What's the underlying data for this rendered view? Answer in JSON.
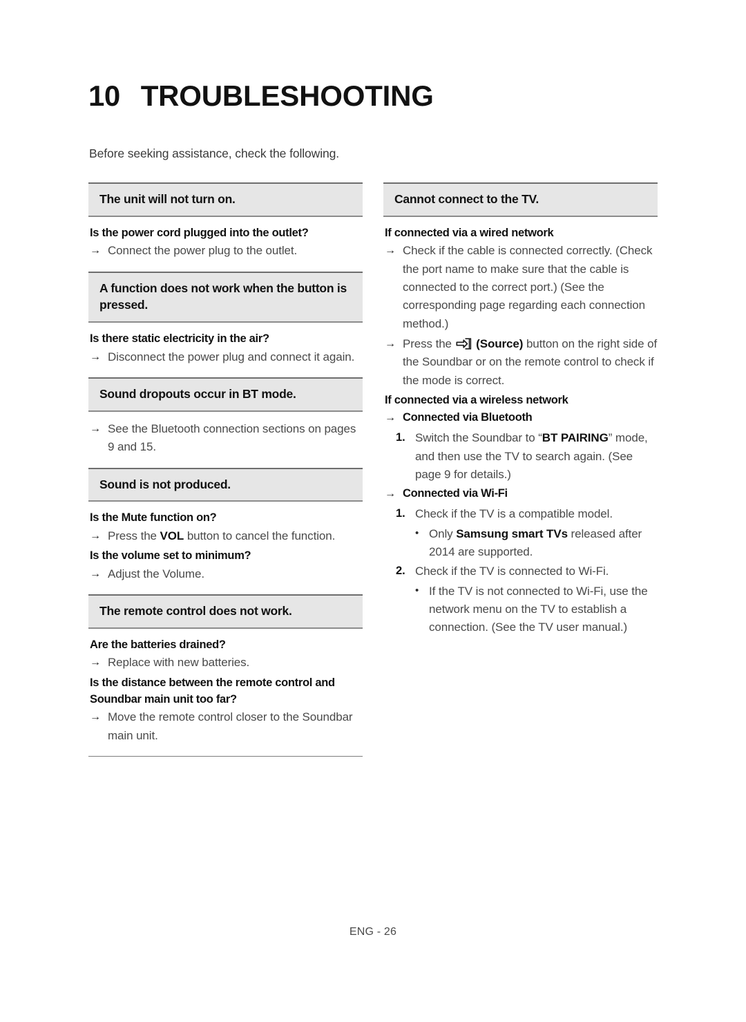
{
  "title": {
    "number": "10",
    "text": "TROUBLESHOOTING"
  },
  "intro": "Before seeking assistance, check the following.",
  "footer": "ENG - 26",
  "icons": {
    "source": "source-icon"
  },
  "left_column": {
    "sections": [
      {
        "heading": "The unit will not turn on.",
        "items": [
          {
            "kind": "question",
            "text": "Is the power cord plugged into the outlet?"
          },
          {
            "kind": "answer",
            "text": "Connect the power plug to the outlet."
          }
        ]
      },
      {
        "heading": "A function does not work when the button is pressed.",
        "items": [
          {
            "kind": "question",
            "text": "Is there static electricity in the air?"
          },
          {
            "kind": "answer",
            "text": "Disconnect the power plug and connect it again."
          }
        ]
      },
      {
        "heading": "Sound dropouts occur in BT mode.",
        "items": [
          {
            "kind": "answer",
            "text": "See the Bluetooth connection sections on pages 9 and 15."
          }
        ]
      },
      {
        "heading": "Sound is not produced.",
        "items": [
          {
            "kind": "question",
            "text": "Is the Mute function on?"
          },
          {
            "kind": "answer_rich",
            "parts": [
              {
                "text": "Press the "
              },
              {
                "text": "VOL",
                "bold": true
              },
              {
                "text": " button to cancel the function."
              }
            ]
          },
          {
            "kind": "question",
            "text": "Is the volume set to minimum?"
          },
          {
            "kind": "answer",
            "text": "Adjust the Volume."
          }
        ]
      },
      {
        "heading": "The remote control does not work.",
        "items": [
          {
            "kind": "question",
            "text": "Are the batteries drained?"
          },
          {
            "kind": "answer",
            "text": "Replace with new batteries."
          },
          {
            "kind": "question",
            "text": "Is the distance between the remote control and Soundbar main unit too far?"
          },
          {
            "kind": "answer",
            "text": "Move the remote control closer to the Soundbar main unit."
          }
        ]
      }
    ]
  },
  "right_column": {
    "sections": [
      {
        "heading": "Cannot connect to the TV.",
        "items": [
          {
            "kind": "question",
            "text": "If connected via a wired network"
          },
          {
            "kind": "answer",
            "text": "Check if the cable is connected correctly. (Check the port name to make sure that the cable is connected to the correct port.) (See the corresponding page regarding each connection method.)"
          },
          {
            "kind": "answer_rich",
            "parts": [
              {
                "text": "Press the "
              },
              {
                "icon": "source-icon"
              },
              {
                "text": " (Source)",
                "bold": true
              },
              {
                "text": " button on the right side of the Soundbar or on the remote control to check if the mode is correct."
              }
            ]
          },
          {
            "kind": "question",
            "text": "If connected via a wireless network"
          },
          {
            "kind": "answer_bold",
            "text": "Connected via Bluetooth"
          },
          {
            "kind": "numbered",
            "marker": "1.",
            "parts": [
              {
                "text": "Switch the Soundbar to “"
              },
              {
                "text": "BT PAIRING",
                "bold": true
              },
              {
                "text": "” mode, and then use the TV to search again. (See page 9 for details.)"
              }
            ]
          },
          {
            "kind": "answer_bold",
            "text": "Connected via Wi-Fi"
          },
          {
            "kind": "numbered",
            "marker": "1.",
            "parts": [
              {
                "text": "Check if the TV is a compatible model."
              }
            ]
          },
          {
            "kind": "bullet",
            "parts": [
              {
                "text": "Only "
              },
              {
                "text": "Samsung smart TVs",
                "bold": true
              },
              {
                "text": " released after 2014 are supported."
              }
            ]
          },
          {
            "kind": "numbered",
            "marker": "2.",
            "parts": [
              {
                "text": "Check if the TV is connected to Wi-Fi."
              }
            ]
          },
          {
            "kind": "bullet",
            "parts": [
              {
                "text": "If the TV is not connected to Wi-Fi, use the network menu on the TV to establish a connection. (See the TV user manual.)"
              }
            ]
          }
        ]
      }
    ]
  }
}
